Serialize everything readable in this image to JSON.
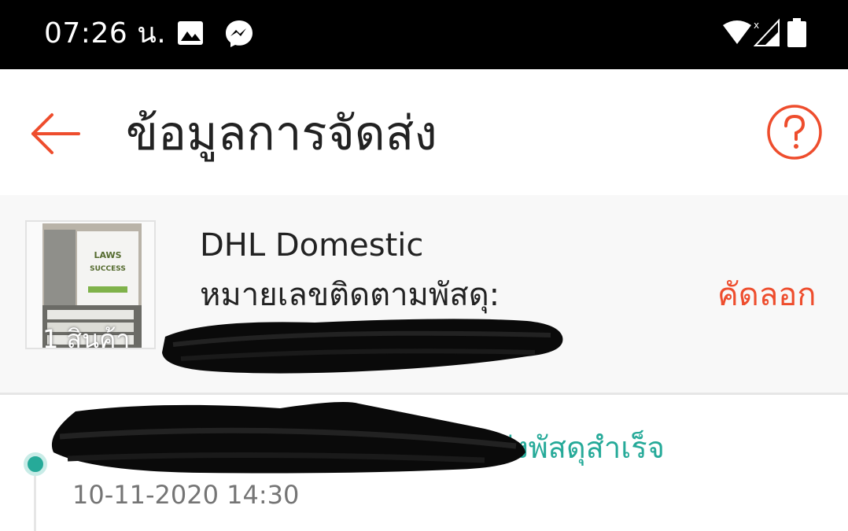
{
  "status_bar": {
    "time": "07:26 น.",
    "icons": [
      "gallery-icon",
      "messenger-icon",
      "wifi-icon",
      "signal-icon",
      "battery-icon"
    ]
  },
  "app_bar": {
    "title": "ข้อมูลการจัดส่ง",
    "back_icon": "arrow-left-icon",
    "help_icon": "question-circle-icon"
  },
  "shipment": {
    "item_count": "1 สินค้า",
    "thumb_title": "LAWS OF SUCCESS",
    "carrier": "DHL Domestic",
    "tracking_label": "หมายเลขติดตามพัสดุ:",
    "copy_label": "คัดลอก"
  },
  "timeline": {
    "events": [
      {
        "status": "ส่งพัสดุสำเร็จ",
        "datetime": "10-11-2020 14:30"
      }
    ]
  },
  "colors": {
    "accent": "#ee4d2d",
    "success": "#26aa99",
    "status_bar": "#000000"
  }
}
